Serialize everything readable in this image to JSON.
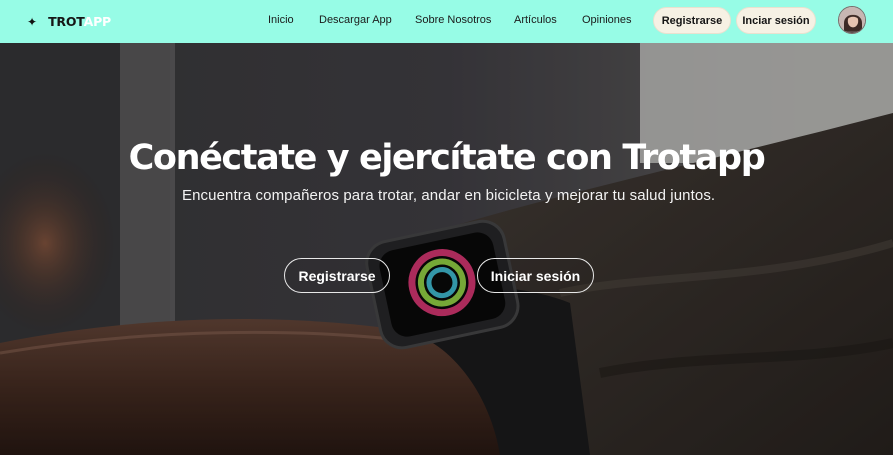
{
  "brand": {
    "star": "✦",
    "name_part1": "TROT",
    "name_part2": "APP"
  },
  "nav": {
    "links": [
      "Inicio",
      "Descargar App",
      "Sobre Nosotros",
      "Artículos",
      "Opiniones"
    ],
    "register_label": "Registrarse",
    "login_label": "Inciar sesión",
    "avatar_icon": "user-avatar"
  },
  "hero": {
    "title": "Conéctate y ejercítate con Trotapp",
    "subtitle": "Encuentra compañeros para trotar, andar en bicicleta y mejorar tu salud juntos.",
    "register_label": "Registrarse",
    "login_label": "Iniciar sesión"
  },
  "colors": {
    "nav_bg": "#97fce6",
    "pill_bg": "#f6f1e4",
    "hero_text": "#ffffff"
  }
}
